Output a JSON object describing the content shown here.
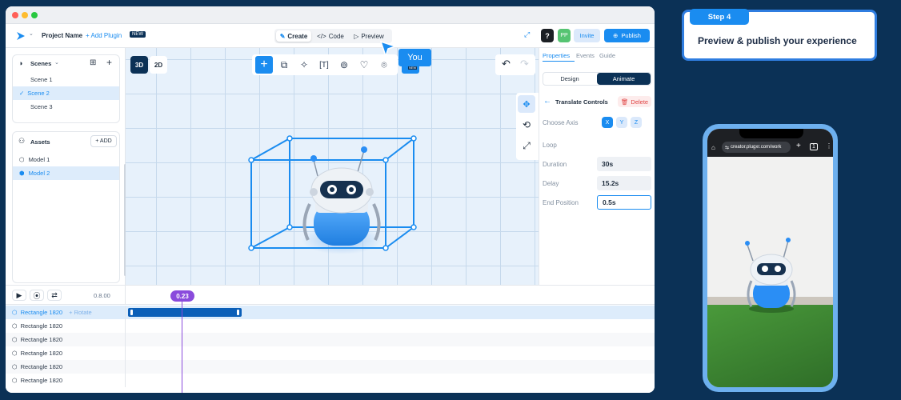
{
  "app": {
    "project_name": "Project Name",
    "add_plugin": "+ Add Plugin",
    "new_badge": "NEW",
    "invite": "Invite",
    "publish": "Publish",
    "avatar": "PP",
    "help": "?"
  },
  "modes": {
    "create": "Create",
    "code": "Code",
    "preview": "Preview"
  },
  "cursor_label": "You",
  "scenes": {
    "title": "Scenes",
    "items": [
      "Scene 1",
      "Scene 2",
      "Scene 3"
    ],
    "selected": "Scene 2"
  },
  "assets": {
    "title": "Assets",
    "add": "+ ADD",
    "items": [
      "Model 1",
      "Model 2"
    ],
    "selected": "Model 2"
  },
  "view_toggle": {
    "d3": "3D",
    "d2": "2D"
  },
  "right_panel": {
    "tabs": [
      "Properties",
      "Events",
      "Guide"
    ],
    "segment": [
      "Design",
      "Animate"
    ],
    "section": "Translate Controls",
    "delete": "Delete",
    "choose_axis": "Choose Axis",
    "axes": [
      "X",
      "Y",
      "Z"
    ],
    "loop": "Loop",
    "fields": [
      {
        "label": "Duration",
        "value": "30s"
      },
      {
        "label": "Delay",
        "value": "15.2s"
      },
      {
        "label": "End Position",
        "value": "0.5s"
      }
    ]
  },
  "timeline": {
    "time": "0.8.00",
    "playhead": "0.23",
    "rows": [
      {
        "name": "Rectangle 1820",
        "extra": "+ Rotate"
      },
      {
        "name": "Rectangle 1820",
        "extra": ""
      },
      {
        "name": "Rectangle 1820",
        "extra": ""
      },
      {
        "name": "Rectangle 1820",
        "extra": ""
      },
      {
        "name": "Rectangle 1820",
        "extra": ""
      },
      {
        "name": "Rectangle 1820",
        "extra": ""
      }
    ]
  },
  "step": {
    "badge": "Step 4",
    "text": "Preview & publish your experience"
  },
  "phone": {
    "url": "creator.plugxr.com/work"
  },
  "colors": {
    "brand": "#1a8cf0",
    "dark": "#0b3156",
    "selected_row": "#ddecfb",
    "playhead": "#8a4bdc"
  }
}
